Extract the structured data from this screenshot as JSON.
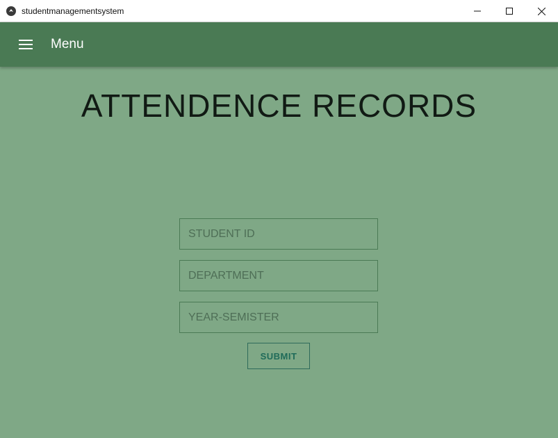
{
  "window": {
    "title": "studentmanagementsystem"
  },
  "toolbar": {
    "menu_label": "Menu"
  },
  "main": {
    "heading": "ATTENDENCE RECORDS",
    "fields": {
      "student_id_placeholder": "STUDENT ID",
      "department_placeholder": "DEPARTMENT",
      "year_semister_placeholder": "YEAR-SEMISTER"
    },
    "submit_label": "SUBMIT"
  },
  "colors": {
    "background": "#7fa886",
    "toolbar": "#4a7a54",
    "accent": "#1f6b59"
  }
}
